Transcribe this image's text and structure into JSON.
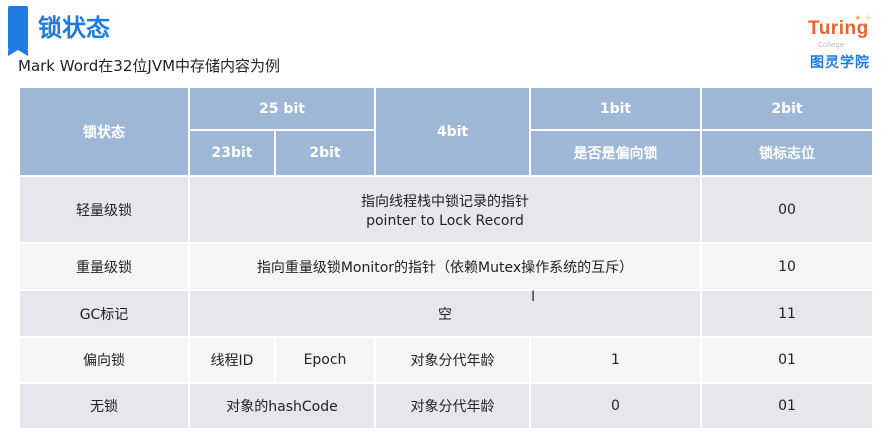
{
  "header": {
    "title": "锁状态",
    "subtitle": "Mark Word在32位JVM中存储内容为例"
  },
  "logo": {
    "brand": "Turing",
    "tagline": "College",
    "name_cn": "图灵学院",
    "colors": {
      "brand": "#e8632a",
      "cn": "#1e7be0"
    }
  },
  "table": {
    "header": {
      "lock_state": "锁状态",
      "bits25": "25 bit",
      "bits4": "4bit",
      "bit1": "1bit",
      "bit2": "2bit",
      "bits23": "23bit",
      "bits2": "2bit",
      "biased_flag": "是否是偏向锁",
      "lock_flag": "锁标志位"
    },
    "rows": {
      "light": {
        "state": "轻量级锁",
        "content_line1": "指向线程栈中锁记录的指针",
        "content_line2": "pointer to Lock Record",
        "flag": "00"
      },
      "heavy": {
        "state": "重量级锁",
        "content": "指向重量级锁Monitor的指针（依赖Mutex操作系统的互斥）",
        "flag": "10"
      },
      "gc": {
        "state": "GC标记",
        "content": "空",
        "flag": "11"
      },
      "biased": {
        "state": "偏向锁",
        "thread_id": "线程ID",
        "epoch": "Epoch",
        "age": "对象分代年龄",
        "biased": "1",
        "flag": "01"
      },
      "unlocked": {
        "state": "无锁",
        "hashcode": "对象的hashCode",
        "age": "对象分代年龄",
        "biased": "0",
        "flag": "01"
      }
    },
    "colors": {
      "header_bg": "#9eb7d6",
      "row_dark": "#e5e7ec",
      "row_light": "#f4f5f7"
    }
  }
}
